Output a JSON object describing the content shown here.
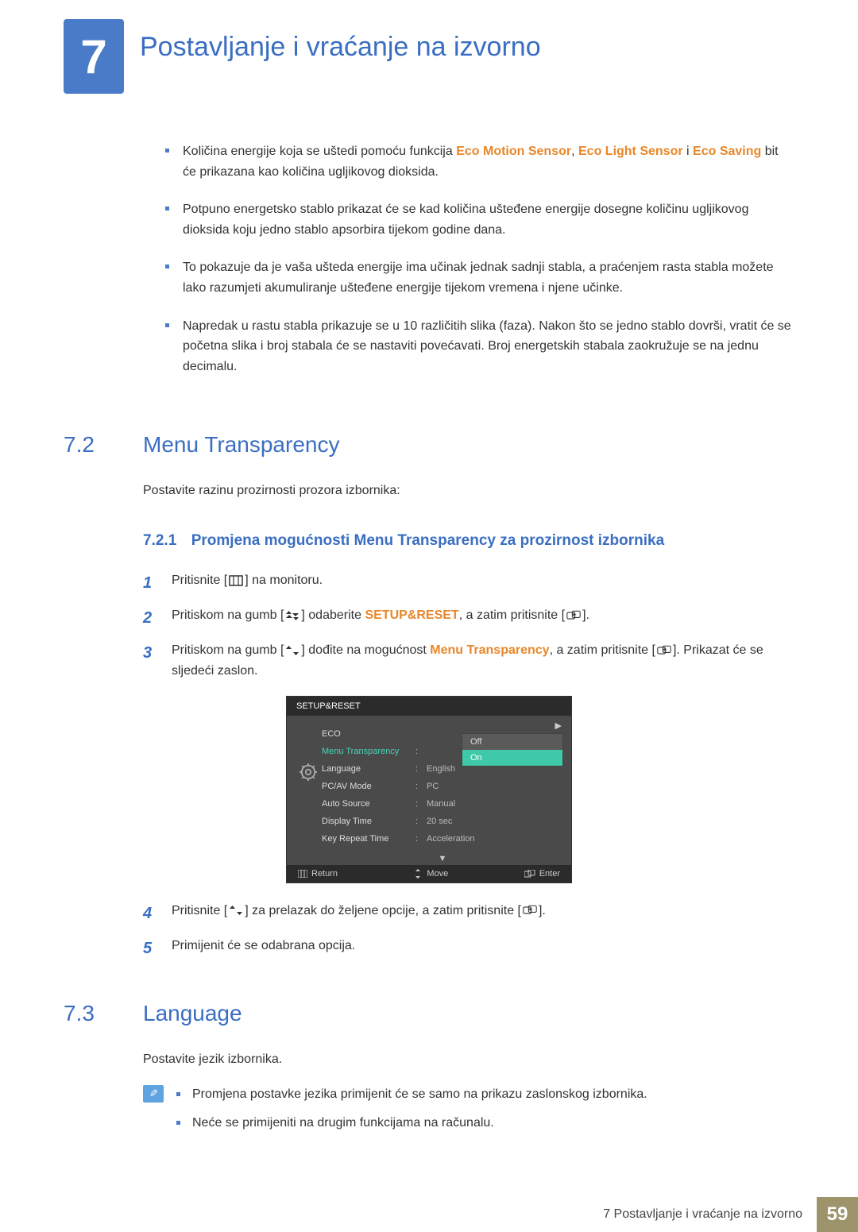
{
  "chapter": {
    "num": "7",
    "title": "Postavljanje i vraćanje na izvorno"
  },
  "intro_bullets": [
    {
      "pre": "Količina energije koja se uštedi pomoću funkcija ",
      "h1": "Eco Motion Sensor",
      "sep1": ", ",
      "h2": "Eco Light Sensor",
      "sep2": " i ",
      "h3": "Eco Saving",
      "post": " bit će prikazana kao količina ugljikovog dioksida."
    },
    {
      "text": "Potpuno energetsko stablo prikazat će se kad količina ušteđene energije dosegne količinu ugljikovog dioksida koju jedno stablo apsorbira tijekom godine dana."
    },
    {
      "text": "To pokazuje da je vaša ušteda energije ima učinak jednak sadnji stabla, a praćenjem rasta stabla možete lako razumjeti akumuliranje ušteđene energije tijekom vremena i njene učinke."
    },
    {
      "text": "Napredak u rastu stabla prikazuje se u 10 različitih slika (faza). Nakon što se jedno stablo dovrši, vratit će se početna slika i broj stabala će se nastaviti povećavati. Broj energetskih stabala zaokružuje se na jednu decimalu."
    }
  ],
  "section_72": {
    "num": "7.2",
    "title": "Menu Transparency",
    "intro": "Postavite razinu prozirnosti prozora izbornika:",
    "sub": {
      "num": "7.2.1",
      "title": "Promjena mogućnosti Menu Transparency za prozirnost izbornika"
    },
    "steps": {
      "s1_pre": "Pritisnite [",
      "s1_post": "] na monitoru.",
      "s2_pre": "Pritiskom na gumb [",
      "s2_mid": "] odaberite ",
      "s2_key": "SETUP&RESET",
      "s2_mid2": ", a zatim pritisnite [",
      "s2_post": "].",
      "s3_pre": "Pritiskom na gumb [",
      "s3_mid": "] dođite na mogućnost ",
      "s3_key": "Menu Transparency",
      "s3_mid2": ", a zatim pritisnite [",
      "s3_post": "]. Prikazat će se sljedeći zaslon.",
      "s4_pre": "Pritisnite [",
      "s4_mid": "] za prelazak do željene opcije, a zatim pritisnite [",
      "s4_post": "].",
      "s5": "Primijenit će se odabrana opcija."
    }
  },
  "osd": {
    "title": "SETUP&RESET",
    "items": [
      {
        "label": "ECO",
        "value": ""
      },
      {
        "label": "Menu Transparency",
        "value": "On",
        "selected": true
      },
      {
        "label": "Language",
        "value": "English"
      },
      {
        "label": "PC/AV Mode",
        "value": "PC"
      },
      {
        "label": "Auto Source",
        "value": "Manual"
      },
      {
        "label": "Display Time",
        "value": "20 sec"
      },
      {
        "label": "Key Repeat Time",
        "value": "Acceleration"
      }
    ],
    "popup": {
      "off": "Off",
      "on": "On"
    },
    "footer": {
      "return": "Return",
      "move": "Move",
      "enter": "Enter"
    }
  },
  "section_73": {
    "num": "7.3",
    "title": "Language",
    "intro": "Postavite jezik izbornika.",
    "notes": [
      "Promjena postavke jezika primijenit će se samo na prikazu zaslonskog izbornika.",
      "Neće se primijeniti na drugim funkcijama na računalu."
    ]
  },
  "footer": {
    "text": "7 Postavljanje i vraćanje na izvorno",
    "page": "59"
  }
}
